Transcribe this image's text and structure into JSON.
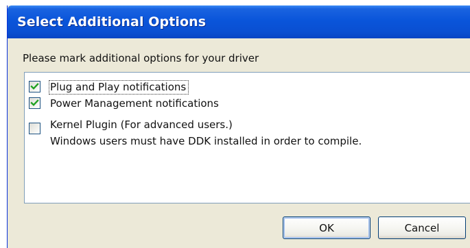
{
  "dialog": {
    "title": "Select Additional Options",
    "prompt": "Please mark additional options for your driver"
  },
  "options": [
    {
      "label": "Plug and Play notifications",
      "checked": true
    },
    {
      "label": "Power Management notifications",
      "checked": true
    },
    {
      "label": "Kernel Plugin (For advanced users.)",
      "sublabel": "Windows users must have DDK installed in order to compile.",
      "checked": false
    }
  ],
  "buttons": {
    "ok_label": "OK",
    "cancel_label": "Cancel"
  },
  "colors": {
    "titlebar": "#0a55da",
    "dialog_bg": "#ece9d8",
    "checkmark": "#21a121"
  }
}
